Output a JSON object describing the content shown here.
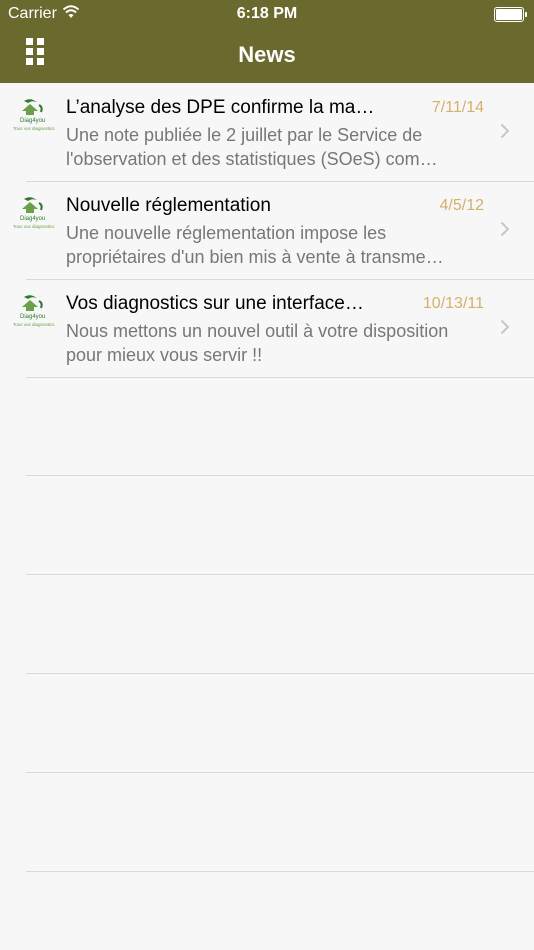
{
  "status_bar": {
    "carrier": "Carrier",
    "time": "6:18 PM"
  },
  "nav": {
    "title": "News"
  },
  "logo": {
    "brand": "Diag4you",
    "tagline": "Tous vos diagnostics"
  },
  "news": [
    {
      "title": "L’analyse des DPE confirme la ma…",
      "date": "7/11/14",
      "snippet": "Une note publiée le 2 juillet par le Service de l'observation et des statistiques (SOeS) com…"
    },
    {
      "title": "Nouvelle réglementation",
      "date": "4/5/12",
      "snippet": "Une nouvelle réglementation impose les propriétaires d'un bien mis à vente à transme…"
    },
    {
      "title": "Vos diagnostics sur une interface…",
      "date": "10/13/11",
      "snippet": "Nous mettons un nouvel outil à votre disposition pour mieux vous servir !!"
    }
  ],
  "colors": {
    "header": "#6b6a2e",
    "date": "#d6b06a",
    "snippet": "#777777"
  },
  "icons": {
    "menu": "grid-menu-icon",
    "chevron": "chevron-right-icon",
    "wifi": "wifi-icon",
    "battery": "battery-icon"
  }
}
